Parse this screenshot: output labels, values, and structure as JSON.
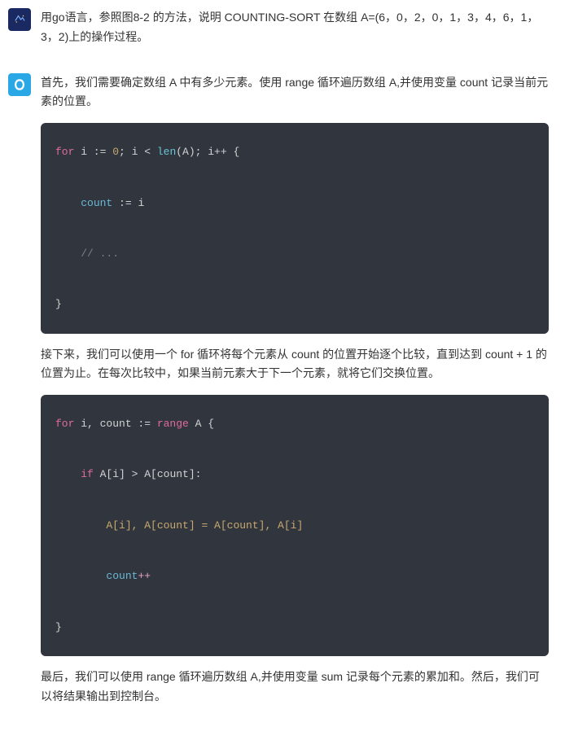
{
  "user_message": "用go语言，参照图8-2 的方法，说明 COUNTING-SORT 在数组 A=(6，0，2，0，1，3，4，6，1，3，2)上的操作过程。",
  "bot": {
    "p1": "首先，我们需要确定数组 A 中有多少元素。使用 range 循环遍历数组 A,并使用变量 count 记录当前元素的位置。",
    "p2": "接下来，我们可以使用一个 for 循环将每个元素从 count 的位置开始逐个比较，直到达到 count + 1 的位置为止。在每次比较中，如果当前元素大于下一个元素，就将它们交换位置。",
    "p3": "最后，我们可以使用 range 循环遍历数组 A,并使用变量 sum 记录每个元素的累加和。然后，我们可以将结果输出到控制台。"
  },
  "code1": {
    "l1_for": "for",
    "l1_rest": " i := ",
    "l1_zero": "0",
    "l1_mid": "; i < ",
    "l1_len": "len",
    "l1_paren": "(A); i++ {",
    "l2_count": "count",
    "l2_assign": " := i",
    "l3_comment": "// ...",
    "l4_close": "}"
  },
  "code2": {
    "l1_for": "for",
    "l1_rest": " i, count := ",
    "l1_range": "range",
    "l1_A": " A {",
    "l2_if": "if",
    "l2_cond": " A[i] > A[count]:",
    "l3_swap": "A[i], A[count] = A[count], A[i]",
    "l4_count": "count",
    "l4_inc": "++",
    "l5_close": "}"
  }
}
